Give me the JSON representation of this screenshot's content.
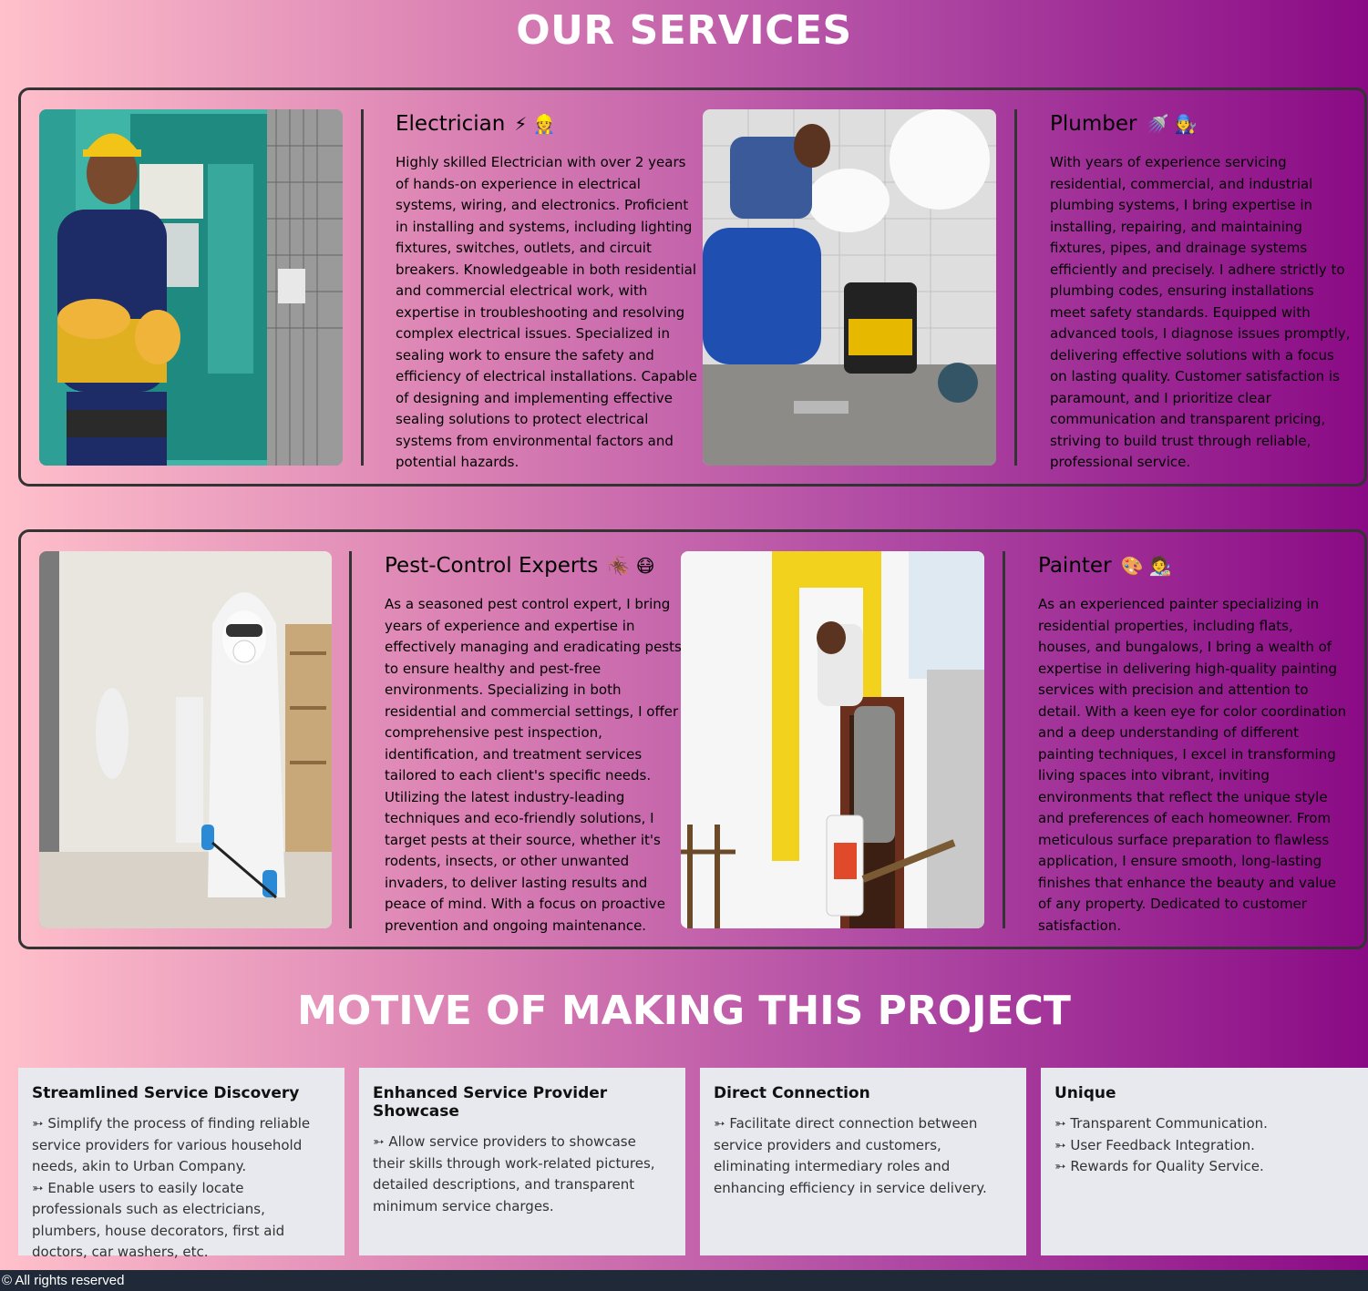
{
  "services_title": "OUR SERVICES",
  "services": [
    {
      "title": "Electrician",
      "emoji": "⚡ 👷",
      "description": "Highly skilled Electrician with over 2 years of hands-on experience in electrical systems, wiring, and electronics. Proficient in installing and systems, including lighting fixtures, switches, outlets, and circuit breakers. Knowledgeable in both residential and commercial electrical work, with expertise in troubleshooting and resolving complex electrical issues. Specialized in sealing work to ensure the safety and efficiency of electrical installations. Capable of designing and implementing effective sealing solutions to protect electrical systems from environmental factors and potential hazards."
    },
    {
      "title": "Plumber",
      "emoji": "🚿 🧑‍🔧",
      "description": "With years of experience servicing residential, commercial, and industrial plumbing systems, I bring expertise in installing, repairing, and maintaining fixtures, pipes, and drainage systems efficiently and precisely. I adhere strictly to plumbing codes, ensuring installations meet safety standards. Equipped with advanced tools, I diagnose issues promptly, delivering effective solutions with a focus on lasting quality. Customer satisfaction is paramount, and I prioritize clear communication and transparent pricing, striving to build trust through reliable, professional service."
    },
    {
      "title": "Pest-Control Experts",
      "emoji": "🪳 😷",
      "description": "As a seasoned pest control expert, I bring years of experience and expertise in effectively managing and eradicating pests to ensure healthy and pest-free environments. Specializing in both residential and commercial settings, I offer comprehensive pest inspection, identification, and treatment services tailored to each client's specific needs. Utilizing the latest industry-leading techniques and eco-friendly solutions, I target pests at their source, whether it's rodents, insects, or other unwanted invaders, to deliver lasting results and peace of mind. With a focus on proactive prevention and ongoing maintenance."
    },
    {
      "title": "Painter",
      "emoji": "🎨 🧑‍🎨",
      "description": "As an experienced painter specializing in residential properties, including flats, houses, and bungalows, I bring a wealth of expertise in delivering high-quality painting services with precision and attention to detail. With a keen eye for color coordination and a deep understanding of different painting techniques, I excel in transforming living spaces into vibrant, inviting environments that reflect the unique style and preferences of each homeowner. From meticulous surface preparation to flawless application, I ensure smooth, long-lasting finishes that enhance the beauty and value of any property. Dedicated to customer satisfaction."
    }
  ],
  "motive_title": "MOTIVE OF MAKING THIS PROJECT",
  "motives": [
    {
      "title": "Streamlined Service Discovery",
      "points": [
        "➳ Simplify the process of finding reliable service providers for various household needs, akin to Urban Company.",
        "➳ Enable users to easily locate professionals such as electricians, plumbers, house decorators, first aid doctors, car washers, etc."
      ]
    },
    {
      "title": "Enhanced Service Provider Showcase",
      "points": [
        "➳ Allow service providers to showcase their skills through work-related pictures, detailed descriptions, and transparent minimum service charges."
      ]
    },
    {
      "title": "Direct Connection",
      "points": [
        "➳ Facilitate direct connection between service providers and customers, eliminating intermediary roles and enhancing efficiency in service delivery."
      ]
    },
    {
      "title": "Unique",
      "points": [
        "➳ Transparent Communication.",
        "➳ User Feedback Integration.",
        "➳ Rewards for Quality Service."
      ]
    }
  ],
  "footer": "© All rights reserved"
}
